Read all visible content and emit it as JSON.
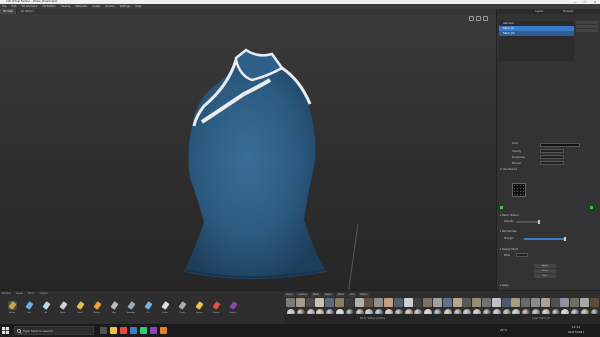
{
  "window": {
    "title": "CLO Virtual Fashion - [Dress_Project.zprj]",
    "min": "—",
    "max": "☐",
    "close": "✕"
  },
  "menu": [
    "File",
    "Edit",
    "3D Garment",
    "2D Pattern",
    "Sewing",
    "Materials",
    "Avatar",
    "Render",
    "Settings",
    "Help"
  ],
  "doc_tabs": [
    "3D View",
    "2D Pattern"
  ],
  "panel": {
    "tab1": "Layers",
    "tab2": "Property",
    "layers": [
      {
        "label": "Garment"
      },
      {
        "label": "Fabric_01"
      },
      {
        "label": "Fabric_02"
      }
    ],
    "props": {
      "color_label": "Color",
      "opacity_label": "Opacity",
      "roughness_label": "Roughness",
      "normal_label": "Normal",
      "use_texture": "Use Texture",
      "sec1": "Fabric Texture",
      "sec1_item": "Intensity",
      "sec2": "Normal Map",
      "sec2_item": "Strength",
      "sec3": "Display Mode",
      "sec3_item": "Mode",
      "btn1": "Apply",
      "btn2": "Reset",
      "btn3": "Save",
      "footer": "Apply"
    }
  },
  "shelf": {
    "tabs": [
      "Brushes",
      "Layers",
      "Fabric",
      "Graphic"
    ],
    "tools": [
      {
        "name": "brush",
        "label": "Brush",
        "color": "#c9a24a"
      },
      {
        "name": "pen",
        "label": "Pen",
        "color": "#6ab0e8"
      },
      {
        "name": "airbrush",
        "label": "Air",
        "color": "#b8d8f0"
      },
      {
        "name": "eraser",
        "label": "Erase",
        "color": "#d0d0d0"
      },
      {
        "name": "pencil",
        "label": "Pencil",
        "color": "#e0c050"
      },
      {
        "name": "marker",
        "label": "Marker",
        "color": "#f0a030"
      },
      {
        "name": "blur",
        "label": "Blur",
        "color": "#bbbbbb"
      },
      {
        "name": "smudge",
        "label": "Smudge",
        "color": "#9ab"
      },
      {
        "name": "fill",
        "label": "Fill",
        "color": "#7ab0e0"
      },
      {
        "name": "picker",
        "label": "Picker",
        "color": "#ddd"
      },
      {
        "name": "clone",
        "label": "Clone",
        "color": "#aaa"
      },
      {
        "name": "stamp",
        "label": "Stamp",
        "color": "#f2c14e"
      },
      {
        "name": "texture",
        "label": "Texture",
        "color": "#e74c3c"
      },
      {
        "name": "pattern",
        "label": "Pattern",
        "color": "#8e44ad"
      }
    ],
    "mat_tabs": [
      "Fabric",
      "Leather",
      "Metal",
      "Plastic",
      "Wood",
      "Knit",
      "Denim"
    ],
    "status_left": "Mode: Texture painting",
    "status_right": "Layer: Fabric_01"
  },
  "taskbar": {
    "search": "Type here to search",
    "weather": "22°C",
    "time": "11:14",
    "date": "01/07/2021"
  },
  "colors": {
    "garment": "#2b5a80",
    "trim": "#e9edf2",
    "accent": "#3a7cc7"
  }
}
